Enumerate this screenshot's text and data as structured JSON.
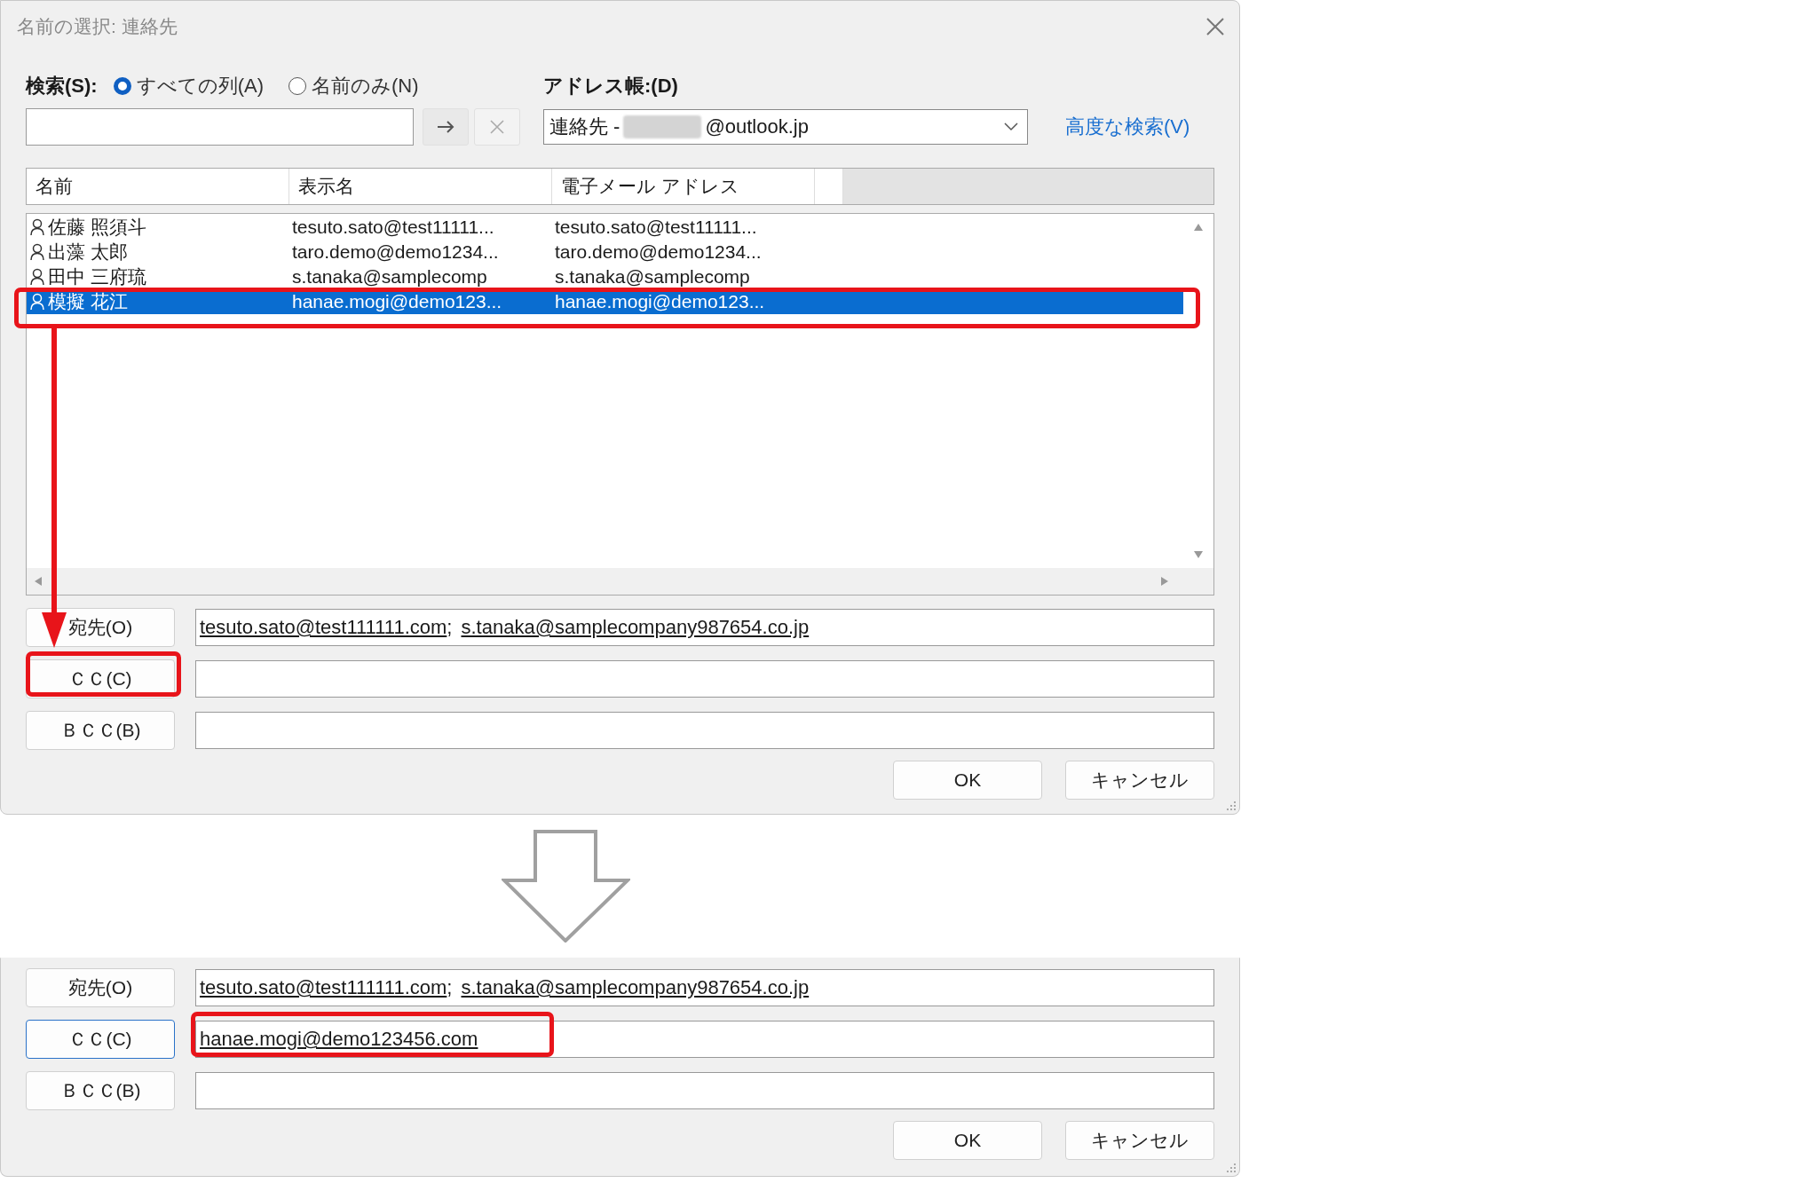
{
  "window": {
    "title": "名前の選択: 連絡先"
  },
  "search": {
    "label": "検索(S):",
    "options": [
      {
        "label": "すべての列(A)",
        "selected": true
      },
      {
        "label": "名前のみ(N)",
        "selected": false
      }
    ]
  },
  "address_book": {
    "label": "アドレス帳:(D)",
    "prefix": "連絡先 -",
    "suffix": "@outlook.jp"
  },
  "advanced_search_link": "高度な検索(V)",
  "table": {
    "columns": [
      "名前",
      "表示名",
      "電子メール アドレス"
    ],
    "rows": [
      {
        "name": "佐藤 照須斗",
        "display_name": "tesuto.sato@test11111...",
        "email": "tesuto.sato@test11111...",
        "selected": false
      },
      {
        "name": "出藻 太郎",
        "display_name": "taro.demo@demo1234...",
        "email": "taro.demo@demo1234...",
        "selected": false
      },
      {
        "name": "田中 三府琉",
        "display_name": "s.tanaka@samplecomp",
        "email": "s.tanaka@samplecomp",
        "selected": false
      },
      {
        "name": "模擬 花江",
        "display_name": "hanae.mogi@demo123...",
        "email": "hanae.mogi@demo123...",
        "selected": true
      }
    ]
  },
  "recipients": [
    {
      "label": "宛先(O)",
      "focused": false,
      "addresses": [
        {
          "text": "tesuto.sato@test111111.com",
          "separator": ";"
        },
        {
          "text": "s.tanaka@samplecompany987654.co.jp"
        }
      ]
    },
    {
      "label": "ＣＣ(C)",
      "focused": false
    },
    {
      "label": "ＢＣＣ(B)",
      "focused": false
    }
  ],
  "buttons": [
    "OK",
    "キャンセル"
  ],
  "result": {
    "recipients": [
      {
        "label": "宛先(O)",
        "focused": false,
        "addresses": [
          {
            "text": "tesuto.sato@test111111.com",
            "separator": ";"
          },
          {
            "text": "s.tanaka@samplecompany987654.co.jp"
          }
        ]
      },
      {
        "label": "ＣＣ(C)",
        "focused": true,
        "addresses": [
          {
            "text": "hanae.mogi@demo123456.com"
          }
        ]
      },
      {
        "label": "ＢＣＣ(B)",
        "focused": false
      }
    ],
    "buttons": [
      "OK",
      "キャンセル"
    ]
  }
}
